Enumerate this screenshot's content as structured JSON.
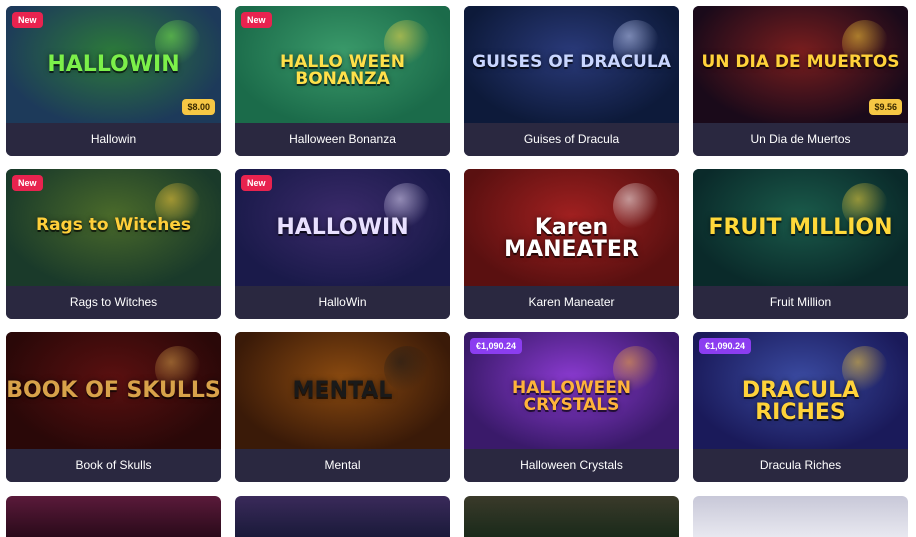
{
  "games": [
    {
      "title": "Hallowin",
      "badge": "New",
      "price": "$8.00",
      "art": "HALLOWIN",
      "colors": [
        "#1d3a5a",
        "#2c7a3a"
      ],
      "artColor": "#7cf04a"
    },
    {
      "title": "Halloween Bonanza",
      "badge": "New",
      "art": "HALLO WEEN BONANZA",
      "colors": [
        "#1b6b4a",
        "#3a9a6a"
      ],
      "artColor": "#ffe04a"
    },
    {
      "title": "Guises of Dracula",
      "art": "GUISES OF DRACULA",
      "colors": [
        "#0d1a3a",
        "#2a3a7a"
      ],
      "artColor": "#c9d6ff"
    },
    {
      "title": "Un Dia de Muertos",
      "price": "$9.56",
      "art": "UN DIA DE MUERTOS",
      "colors": [
        "#1a0a1a",
        "#7a1e1e"
      ],
      "artColor": "#ffd23a"
    },
    {
      "title": "Rags to Witches",
      "badge": "New",
      "art": "Rags to Witches",
      "colors": [
        "#1a3a2a",
        "#4a6a2a"
      ],
      "artColor": "#ffcf3a"
    },
    {
      "title": "HalloWin",
      "badge": "New",
      "art": "HALLOWIN",
      "colors": [
        "#1a1a4a",
        "#3a2a6a"
      ],
      "artColor": "#e8e0ff"
    },
    {
      "title": "Karen Maneater",
      "art": "Karen MANEATER",
      "colors": [
        "#5a1010",
        "#a02020"
      ],
      "artColor": "#ffffff"
    },
    {
      "title": "Fruit Million",
      "art": "FRUIT MILLION",
      "colors": [
        "#0a2a2a",
        "#1a5a4a"
      ],
      "artColor": "#ffd93a"
    },
    {
      "title": "Book of Skulls",
      "art": "BOOK OF SKULLS",
      "colors": [
        "#2a0808",
        "#5a1010"
      ],
      "artColor": "#d8a24a"
    },
    {
      "title": "Mental",
      "art": "MENTAL",
      "colors": [
        "#3a1a08",
        "#8a4a10"
      ],
      "artColor": "#1a1a1a"
    },
    {
      "title": "Halloween Crystals",
      "jackpot": "€1,090.24",
      "art": "HALLOWEEN CRYSTALS",
      "colors": [
        "#3a1a6a",
        "#8a3ad0"
      ],
      "artColor": "#ffb33a"
    },
    {
      "title": "Dracula Riches",
      "jackpot": "€1,090.24",
      "art": "DRACULA RICHES",
      "colors": [
        "#1a1a5a",
        "#3a4aa0"
      ],
      "artColor": "#ffd23a"
    }
  ],
  "partial": [
    {
      "colors": [
        "#2a0a1a",
        "#5a1a3a"
      ]
    },
    {
      "colors": [
        "#1a1a3a",
        "#3a2a5a"
      ]
    },
    {
      "colors": [
        "#1a2a1a",
        "#3a3a2a"
      ]
    },
    {
      "colors": [
        "#e8e8f0",
        "#c8c8d8"
      ]
    }
  ]
}
